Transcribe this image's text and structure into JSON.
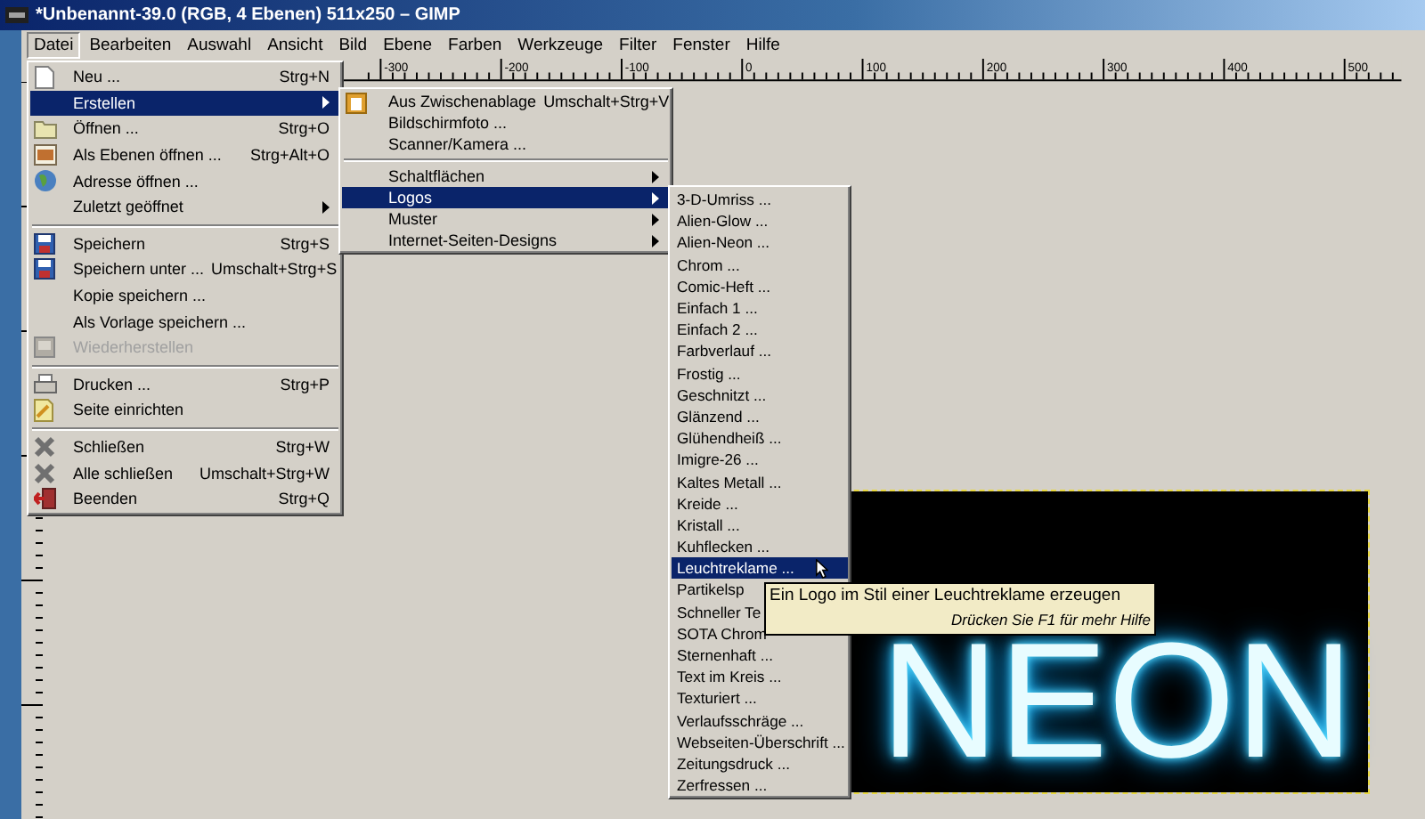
{
  "window": {
    "title": "*Unbenannt-39.0 (RGB, 4 Ebenen) 511x250 – GIMP"
  },
  "menubar": [
    {
      "label": "Datei",
      "selected": true
    },
    {
      "label": "Bearbeiten",
      "selected": false
    },
    {
      "label": "Auswahl",
      "selected": false
    },
    {
      "label": "Ansicht",
      "selected": false
    },
    {
      "label": "Bild",
      "selected": false
    },
    {
      "label": "Ebene",
      "selected": false
    },
    {
      "label": "Farben",
      "selected": false
    },
    {
      "label": "Werkzeuge",
      "selected": false
    },
    {
      "label": "Filter",
      "selected": false
    },
    {
      "label": "Fenster",
      "selected": false
    },
    {
      "label": "Hilfe",
      "selected": false
    }
  ],
  "ruler": {
    "labels": [
      "-300",
      "-200",
      "-100",
      "0",
      "100",
      "200",
      "300",
      "400",
      "500"
    ]
  },
  "canvas": {
    "text": "NEON"
  },
  "file_menu": {
    "items": [
      {
        "kind": "item",
        "label": "Neu ...",
        "shortcut": "Strg+N",
        "submenu": false,
        "selected": false,
        "disabled": false
      },
      {
        "kind": "item",
        "label": "Erstellen",
        "submenu": true,
        "selected": true,
        "disabled": false
      },
      {
        "kind": "item",
        "label": "Öffnen ...",
        "shortcut": "Strg+O",
        "submenu": false,
        "selected": false,
        "disabled": false
      },
      {
        "kind": "item",
        "label": "Als Ebenen öffnen ...",
        "shortcut": "Strg+Alt+O",
        "submenu": false,
        "selected": false,
        "disabled": false
      },
      {
        "kind": "item",
        "label": "Adresse öffnen ...",
        "submenu": false,
        "selected": false,
        "disabled": false
      },
      {
        "kind": "item",
        "label": "Zuletzt geöffnet",
        "submenu": true,
        "selected": false,
        "disabled": false
      },
      {
        "kind": "separator"
      },
      {
        "kind": "item",
        "label": "Speichern",
        "shortcut": "Strg+S",
        "submenu": false,
        "selected": false,
        "disabled": false
      },
      {
        "kind": "item",
        "label": "Speichern unter ...",
        "shortcut": "Umschalt+Strg+S",
        "submenu": false,
        "selected": false,
        "disabled": false
      },
      {
        "kind": "item",
        "label": "Kopie speichern ...",
        "submenu": false,
        "selected": false,
        "disabled": false
      },
      {
        "kind": "item",
        "label": "Als Vorlage speichern ...",
        "submenu": false,
        "selected": false,
        "disabled": false
      },
      {
        "kind": "item",
        "label": "Wiederherstellen",
        "submenu": false,
        "selected": false,
        "disabled": true
      },
      {
        "kind": "separator"
      },
      {
        "kind": "item",
        "label": "Drucken ...",
        "shortcut": "Strg+P",
        "submenu": false,
        "selected": false,
        "disabled": false
      },
      {
        "kind": "item",
        "label": "Seite einrichten",
        "submenu": false,
        "selected": false,
        "disabled": false
      },
      {
        "kind": "separator"
      },
      {
        "kind": "item",
        "label": "Schließen",
        "shortcut": "Strg+W",
        "submenu": false,
        "selected": false,
        "disabled": false
      },
      {
        "kind": "item",
        "label": "Alle schließen",
        "shortcut": "Umschalt+Strg+W",
        "submenu": false,
        "selected": false,
        "disabled": false
      },
      {
        "kind": "item",
        "label": "Beenden",
        "shortcut": "Strg+Q",
        "submenu": false,
        "selected": false,
        "disabled": false
      }
    ]
  },
  "create_menu": {
    "items": [
      {
        "kind": "item",
        "label": "Aus Zwischenablage",
        "shortcut": "Umschalt+Strg+V",
        "submenu": false,
        "selected": false
      },
      {
        "kind": "item",
        "label": "Bildschirmfoto ...",
        "submenu": false,
        "selected": false
      },
      {
        "kind": "item",
        "label": "Scanner/Kamera ...",
        "submenu": false,
        "selected": false
      },
      {
        "kind": "separator"
      },
      {
        "kind": "item",
        "label": "Schaltflächen",
        "submenu": true,
        "selected": false
      },
      {
        "kind": "item",
        "label": "Logos",
        "submenu": true,
        "selected": true
      },
      {
        "kind": "item",
        "label": "Muster",
        "submenu": true,
        "selected": false
      },
      {
        "kind": "item",
        "label": "Internet-Seiten-Designs",
        "submenu": true,
        "selected": false
      }
    ]
  },
  "logos_menu": {
    "items": [
      {
        "kind": "item",
        "label": "3-D-Umriss ...",
        "selected": false
      },
      {
        "kind": "item",
        "label": "Alien-Glow ...",
        "selected": false
      },
      {
        "kind": "item",
        "label": "Alien-Neon ...",
        "selected": false
      },
      {
        "kind": "item",
        "label": "Chrom ...",
        "selected": false
      },
      {
        "kind": "item",
        "label": "Comic-Heft ...",
        "selected": false
      },
      {
        "kind": "item",
        "label": "Einfach 1 ...",
        "selected": false
      },
      {
        "kind": "item",
        "label": "Einfach 2 ...",
        "selected": false
      },
      {
        "kind": "item",
        "label": "Farbverlauf ...",
        "selected": false
      },
      {
        "kind": "item",
        "label": "Frostig ...",
        "selected": false
      },
      {
        "kind": "item",
        "label": "Geschnitzt ...",
        "selected": false
      },
      {
        "kind": "item",
        "label": "Glänzend ...",
        "selected": false
      },
      {
        "kind": "item",
        "label": "Glühendheiß ...",
        "selected": false
      },
      {
        "kind": "item",
        "label": "Imigre-26 ...",
        "selected": false
      },
      {
        "kind": "item",
        "label": "Kaltes Metall ...",
        "selected": false
      },
      {
        "kind": "item",
        "label": "Kreide ...",
        "selected": false
      },
      {
        "kind": "item",
        "label": "Kristall ...",
        "selected": false
      },
      {
        "kind": "item",
        "label": "Kuhflecken ...",
        "selected": false
      },
      {
        "kind": "item",
        "label": "Leuchtreklame ...",
        "selected": true
      },
      {
        "kind": "item",
        "label": "Partikelsp",
        "selected": false
      },
      {
        "kind": "item",
        "label": "Schneller Te",
        "selected": false
      },
      {
        "kind": "item",
        "label": "SOTA Chrom",
        "selected": false
      },
      {
        "kind": "item",
        "label": "Sternenhaft ...",
        "selected": false
      },
      {
        "kind": "item",
        "label": "Text im Kreis ...",
        "selected": false
      },
      {
        "kind": "item",
        "label": "Texturiert ...",
        "selected": false
      },
      {
        "kind": "item",
        "label": "Verlaufsschräge ...",
        "selected": false
      },
      {
        "kind": "item",
        "label": "Webseiten-Überschrift ...",
        "selected": false
      },
      {
        "kind": "item",
        "label": "Zeitungsdruck ...",
        "selected": false
      },
      {
        "kind": "item",
        "label": "Zerfressen ...",
        "selected": false
      }
    ]
  },
  "tooltip": {
    "text": "Ein Logo im Stil einer Leuchtreklame erzeugen",
    "hint": "Drücken Sie F1 für mehr Hilfe"
  }
}
